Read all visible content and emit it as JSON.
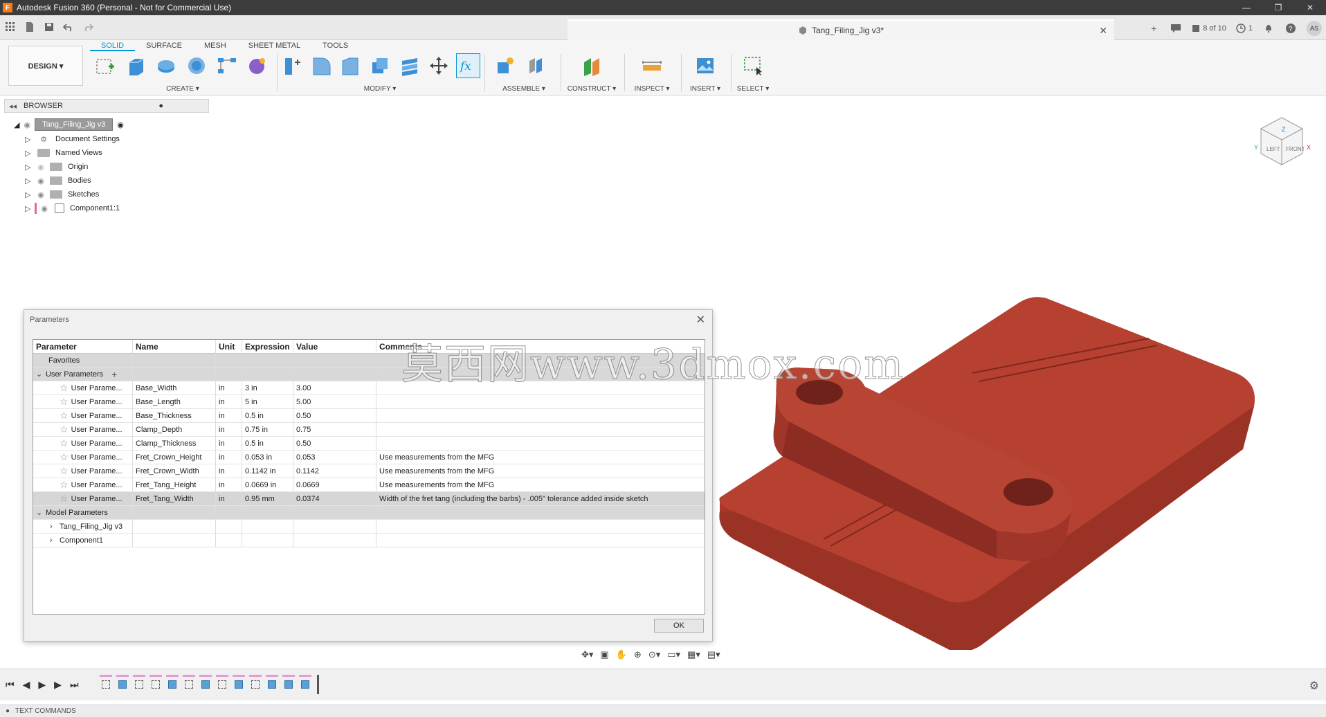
{
  "window": {
    "title": "Autodesk Fusion 360 (Personal - Not for Commercial Use)",
    "logo_letter": "F",
    "minimize": "—",
    "restore": "❐",
    "close": "✕"
  },
  "document_tab": {
    "title": "Tang_Filing_Jig v3*",
    "close": "✕"
  },
  "topbar_right": {
    "plus": "+",
    "counter": "8 of 10",
    "jobs": "1",
    "avatar": "AS"
  },
  "ribbon": {
    "workspace": "DESIGN ▾",
    "tabs": [
      "SOLID",
      "SURFACE",
      "MESH",
      "SHEET METAL",
      "TOOLS"
    ],
    "groups": {
      "create": "CREATE ▾",
      "modify": "MODIFY ▾",
      "assemble": "ASSEMBLE ▾",
      "construct": "CONSTRUCT ▾",
      "inspect": "INSPECT ▾",
      "insert": "INSERT ▾",
      "select": "SELECT ▾"
    }
  },
  "browser": {
    "title": "BROWSER",
    "root": "Tang_Filing_Jig v3",
    "items": [
      "Document Settings",
      "Named Views",
      "Origin",
      "Bodies",
      "Sketches",
      "Component1:1"
    ]
  },
  "parameters": {
    "title": "Parameters",
    "columns": [
      "Parameter",
      "Name",
      "Unit",
      "Expression",
      "Value",
      "Comments"
    ],
    "favorites_label": "Favorites",
    "user_group_label": "User Parameters",
    "add_icon": "+",
    "user_rows": [
      {
        "param": "User Parame...",
        "name": "Base_Width",
        "unit": "in",
        "expression": "3 in",
        "value": "3.00",
        "comment": ""
      },
      {
        "param": "User Parame...",
        "name": "Base_Length",
        "unit": "in",
        "expression": "5 in",
        "value": "5.00",
        "comment": ""
      },
      {
        "param": "User Parame...",
        "name": "Base_Thickness",
        "unit": "in",
        "expression": "0.5 in",
        "value": "0.50",
        "comment": ""
      },
      {
        "param": "User Parame...",
        "name": "Clamp_Depth",
        "unit": "in",
        "expression": "0.75 in",
        "value": "0.75",
        "comment": ""
      },
      {
        "param": "User Parame...",
        "name": "Clamp_Thickness",
        "unit": "in",
        "expression": "0.5 in",
        "value": "0.50",
        "comment": ""
      },
      {
        "param": "User Parame...",
        "name": "Fret_Crown_Height",
        "unit": "in",
        "expression": "0.053 in",
        "value": "0.053",
        "comment": "Use measurements from the MFG"
      },
      {
        "param": "User Parame...",
        "name": "Fret_Crown_Width",
        "unit": "in",
        "expression": "0.1142 in",
        "value": "0.1142",
        "comment": "Use measurements from the MFG"
      },
      {
        "param": "User Parame...",
        "name": "Fret_Tang_Height",
        "unit": "in",
        "expression": "0.0669 in",
        "value": "0.0669",
        "comment": "Use measurements from the MFG"
      },
      {
        "param": "User Parame...",
        "name": "Fret_Tang_Width",
        "unit": "in",
        "expression": "0.95 mm",
        "value": "0.0374",
        "comment": "Width of the fret tang (including the barbs) - .005\" tolerance added inside sketch"
      }
    ],
    "model_group_label": "Model Parameters",
    "model_items": [
      "Tang_Filing_Jig v3",
      "Component1"
    ],
    "ok_label": "OK",
    "close": "✕"
  },
  "watermark": "莫西网www.3dmox.com",
  "viewcube": {
    "left": "LEFT",
    "front": "FRONT",
    "z": "Z",
    "x": "X",
    "y": "Y"
  },
  "bottom": {
    "text_commands": "TEXT COMMANDS"
  },
  "colors": {
    "model": "#b03a2e",
    "model_dark": "#8c2a20",
    "model_light": "#c5493a",
    "accent": "#0696d7",
    "selected_row": "#d6d6d6"
  }
}
